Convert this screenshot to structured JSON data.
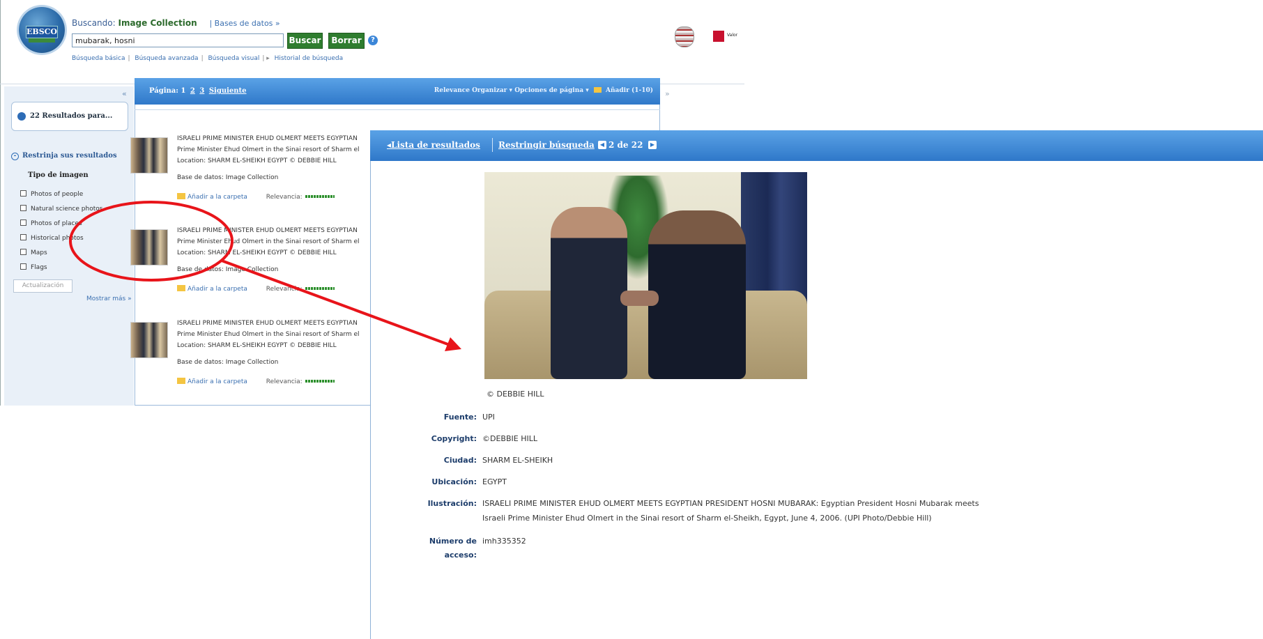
{
  "header": {
    "logo_text": "EBSCO",
    "searching_label": "Buscando:",
    "searching_db": "Image Collection",
    "databases_link": "| Bases de datos »",
    "search_value": "mubarak, hosni",
    "search_button": "Buscar",
    "clear_button": "Borrar",
    "help_icon": "?",
    "links": [
      "Búsqueda básica",
      "Búsqueda avanzada",
      "Búsqueda visual",
      "Historial de búsqueda"
    ],
    "partner_logo_text": "Valor"
  },
  "sidebar": {
    "collapse": "«",
    "results_label": "22 Resultados para...",
    "narrow_heading": "Restrinja sus resultados",
    "image_type_heading": "Tipo de imagen",
    "facets": [
      "Photos of people",
      "Natural science photos",
      "Photos of places",
      "Historical photos",
      "Maps",
      "Flags"
    ],
    "update_button": "Actualización",
    "show_more": "Mostrar más »"
  },
  "results": {
    "pager_label": "Página:",
    "pages": [
      "1",
      "2",
      "3"
    ],
    "next": "Siguiente",
    "options": "Relevance Organizar ▾   Opciones de página ▾",
    "add_label": "Añadir (1-10)",
    "collapse_right": "»",
    "items": [
      {
        "title": "ISRAELI PRIME MINISTER EHUD OLMERT MEETS EGYPTIAN",
        "line1": "Prime Minister Ehud Olmert in the Sinai resort of Sharm el",
        "line2": "Location: SHARM EL-SHEIKH EGYPT © DEBBIE HILL",
        "db": "Base de datos: Image Collection",
        "add_to_folder": "Añadir a la carpeta",
        "relevance_label": "Relevancia:"
      },
      {
        "title": "ISRAELI PRIME MINISTER EHUD OLMERT MEETS EGYPTIAN",
        "line1": "Prime Minister Ehud Olmert in the Sinai resort of Sharm el",
        "line2": "Location: SHARM EL-SHEIKH EGYPT © DEBBIE HILL",
        "db": "Base de datos: Image Collection",
        "add_to_folder": "Añadir a la carpeta",
        "relevance_label": "Relevancia:"
      },
      {
        "title": "ISRAELI PRIME MINISTER EHUD OLMERT MEETS EGYPTIAN",
        "line1": "Prime Minister Ehud Olmert in the Sinai resort of Sharm el",
        "line2": "Location: SHARM EL-SHEIKH EGYPT © DEBBIE HILL",
        "db": "Base de datos: Image Collection",
        "add_to_folder": "Añadir a la carpeta",
        "relevance_label": "Relevancia:"
      }
    ]
  },
  "detail": {
    "back_link": "◂Lista de resultados",
    "refine_link": "Restringir búsqueda",
    "prev": "◀",
    "count": "2 de 22",
    "next": "▶",
    "caption": "© DEBBIE HILL",
    "fields": [
      {
        "label": "Fuente:",
        "value": "UPI"
      },
      {
        "label": "Copyright:",
        "value": "©DEBBIE HILL"
      },
      {
        "label": "Ciudad:",
        "value": "SHARM EL-SHEIKH"
      },
      {
        "label": "Ubicación:",
        "value": "EGYPT"
      },
      {
        "label": "Ilustración:",
        "value": "ISRAELI PRIME MINISTER EHUD OLMERT MEETS EGYPTIAN PRESIDENT HOSNI MUBARAK: Egyptian President Hosni Mubarak meets",
        "value2": "Israeli Prime Minister Ehud Olmert in the Sinai resort of Sharm el-Sheikh, Egypt, June 4, 2006. (UPI Photo/Debbie Hill)"
      },
      {
        "label": "Número de",
        "label2": "acceso:",
        "value": "imh335352"
      }
    ]
  },
  "colors": {
    "toolbar_blue": "#2f78c9",
    "sidebar_bg": "#e9f0f8",
    "green_button": "#2f7d2f",
    "annotation_red": "#e8141a"
  }
}
